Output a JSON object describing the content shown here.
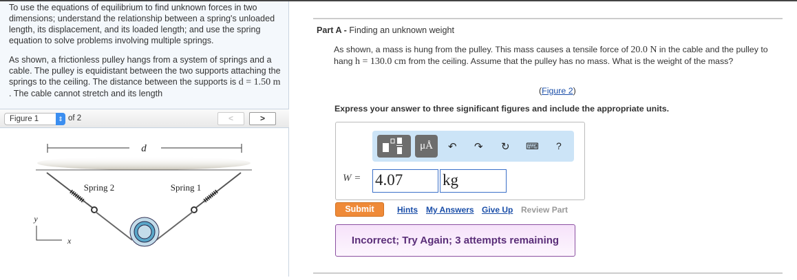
{
  "intro": {
    "p1": "To use the equations of equilibrium to find unknown forces in two dimensions; understand the relationship between a spring's unloaded length, its displacement, and its loaded length; and use the spring equation to solve problems involving multiple springs.",
    "p2_a": "As shown, a frictionless pulley hangs from a system of springs and a cable. The pulley is equidistant between the two supports attaching the springs to the ceiling. The distance between the supports is ",
    "p2_math": "d = 1.50 m",
    "p2_b": " . The cable cannot stretch and its length"
  },
  "figure_nav": {
    "selected": "Figure 1",
    "of": "of 2",
    "prev": "<",
    "next": ">"
  },
  "figure": {
    "d": "d",
    "spring2": "Spring 2",
    "spring1": "Spring 1",
    "y": "y",
    "x": "x"
  },
  "part": {
    "label": "Part A -",
    "title": " Finding an unknown weight",
    "q_a": "As shown, a mass is hung from the pulley. This mass causes a tensile force of ",
    "q_m1": "20.0 N",
    "q_b": " in the cable and the pulley to hang ",
    "q_m2": "h = 130.0 cm",
    "q_c": " from the ceiling. Assume that the pulley has no mass. What is the weight of the mass?",
    "fig_open": "(",
    "fig_link": "Figure 2",
    "fig_close": ")",
    "instruction": "Express your answer to three significant figures and include the appropriate units."
  },
  "answer": {
    "label": "W =",
    "value": "4.07",
    "units": "kg",
    "toolbar": {
      "units_btn": "μÅ",
      "help": "?"
    }
  },
  "actions": {
    "submit": "Submit",
    "hints": "Hints",
    "my_answers": "My Answers",
    "give_up": "Give Up",
    "review": "Review Part"
  },
  "feedback": "Incorrect; Try Again; 3 attempts remaining",
  "colors": {
    "submit": "#ef8a38",
    "link": "#1a4ea8",
    "feedback_text": "#5a2e78",
    "pulley": "#5aa7c9"
  }
}
